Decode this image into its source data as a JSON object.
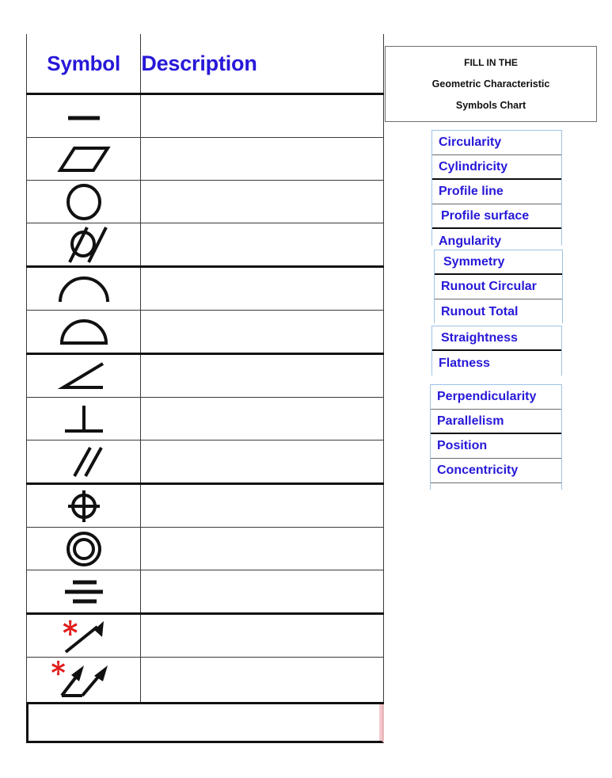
{
  "document": {
    "title_box": {
      "line1": "FILL IN THE",
      "line2": "Geometric Characteristic",
      "line3": "Symbols Chart"
    }
  },
  "table": {
    "headers": {
      "symbol": "Symbol",
      "description": "Description"
    },
    "header_color": "#2718d8",
    "rows": [
      {
        "symbol_name": "straightness-symbol",
        "description": ""
      },
      {
        "symbol_name": "flatness-symbol",
        "description": ""
      },
      {
        "symbol_name": "circularity-symbol",
        "description": ""
      },
      {
        "symbol_name": "cylindricity-symbol",
        "description": ""
      },
      {
        "symbol_name": "profile-of-a-line-symbol",
        "description": ""
      },
      {
        "symbol_name": "profile-of-a-surface-symbol",
        "description": ""
      },
      {
        "symbol_name": "angularity-symbol",
        "description": ""
      },
      {
        "symbol_name": "perpendicularity-symbol",
        "description": ""
      },
      {
        "symbol_name": "parallelism-symbol",
        "description": ""
      },
      {
        "symbol_name": "position-symbol",
        "description": ""
      },
      {
        "symbol_name": "concentricity-symbol",
        "description": ""
      },
      {
        "symbol_name": "symmetry-symbol",
        "description": ""
      },
      {
        "symbol_name": "circular-runout-symbol",
        "description": ""
      },
      {
        "symbol_name": "total-runout-symbol",
        "description": ""
      }
    ]
  },
  "word_bank": {
    "text_color": "#2718d8",
    "groups": [
      {
        "items": [
          "Circularity",
          "Cylindricity",
          "Profile  line",
          "Profile  surface",
          "Angularity"
        ]
      },
      {
        "items": [
          "Symmetry",
          "Runout  Circular",
          "Runout  Total"
        ]
      },
      {
        "items": [
          "Straightness",
          "Flatness"
        ]
      },
      {
        "items": [
          "Perpendicularity",
          "Parallelism",
          "Position",
          "Concentricity"
        ]
      }
    ]
  }
}
